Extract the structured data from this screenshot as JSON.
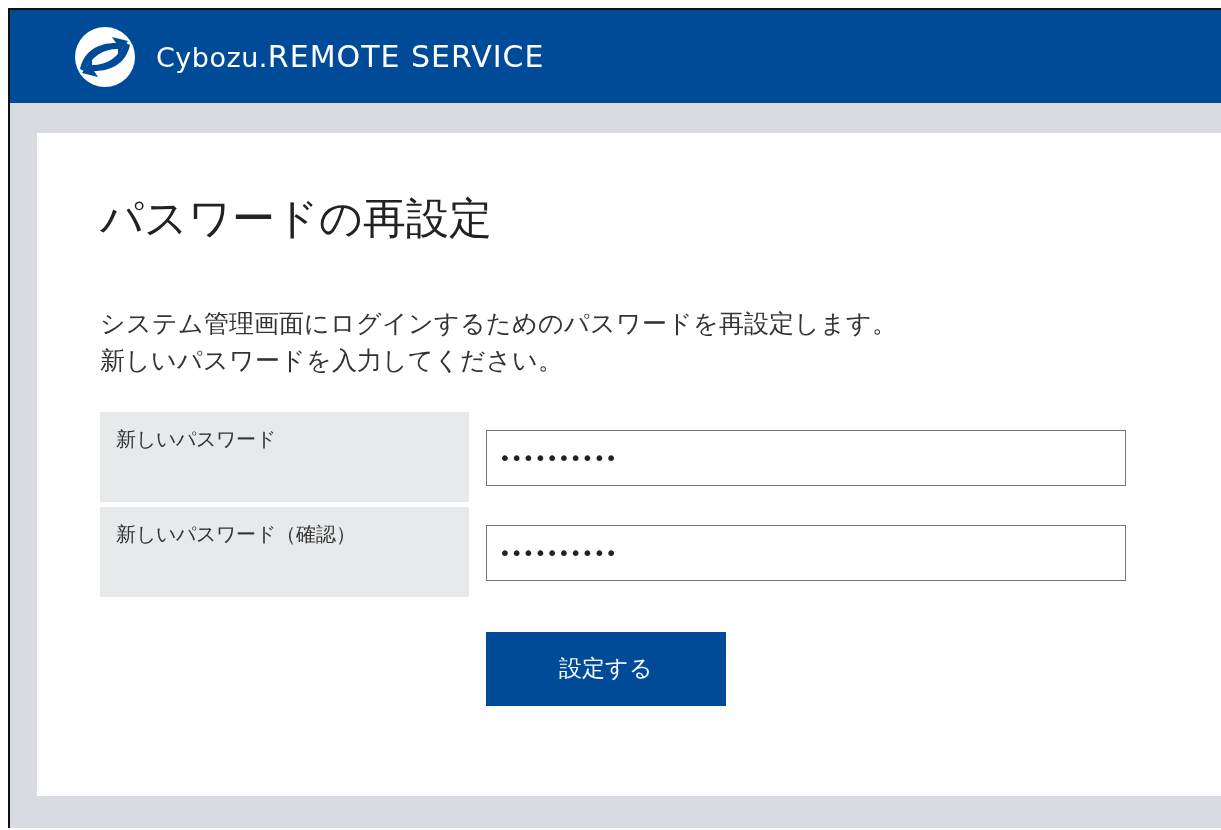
{
  "header": {
    "brand": "Cybozu.",
    "product": "REMOTE SERVICE"
  },
  "page": {
    "title": "パスワードの再設定",
    "description": [
      "システム管理画面にログインするためのパスワードを再設定します。",
      "新しいパスワードを入力してください。"
    ]
  },
  "form": {
    "fields": [
      {
        "label": "新しいパスワード",
        "value": "••••••••••"
      },
      {
        "label": "新しいパスワード（確認）",
        "value": "••••••••••"
      }
    ],
    "submit": "設定する"
  }
}
